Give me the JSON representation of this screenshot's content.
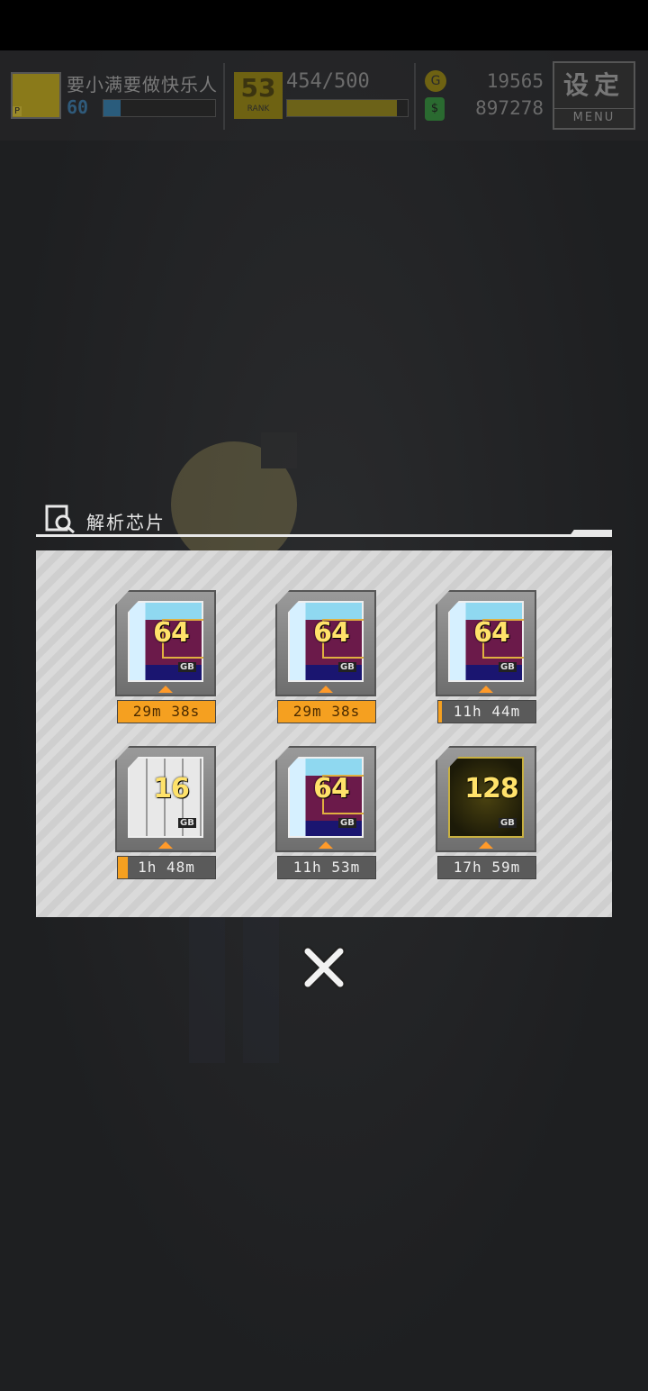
{
  "hud": {
    "player_name": "要小满要做快乐人",
    "avatar_tag": "P",
    "level": "60",
    "level_progress": 0.15,
    "rank": "53",
    "rank_label": "RANK",
    "stamina_text": "454/500",
    "stamina_progress": 0.908,
    "coin_value": "19565",
    "gem_value": "897278",
    "menu_cn": "设定",
    "menu_en": "MENU"
  },
  "dialog": {
    "title": "解析芯片",
    "chips": [
      {
        "capacity": "64",
        "unit": "GB",
        "type": "rainbow",
        "timer": "29m 38s",
        "progress": 1.0
      },
      {
        "capacity": "64",
        "unit": "GB",
        "type": "rainbow",
        "timer": "29m 38s",
        "progress": 1.0
      },
      {
        "capacity": "64",
        "unit": "GB",
        "type": "rainbow",
        "timer": "11h 44m",
        "progress": 0.02
      },
      {
        "capacity": "16",
        "unit": "GB",
        "type": "silver",
        "timer": "1h 48m",
        "progress": 0.1
      },
      {
        "capacity": "64",
        "unit": "GB",
        "type": "rainbow",
        "timer": "11h 53m",
        "progress": 0.0
      },
      {
        "capacity": "128",
        "unit": "GB",
        "type": "gold",
        "timer": "17h 59m",
        "progress": 0.0
      }
    ]
  },
  "colors": {
    "timer_fill": "#f5a020",
    "panel_bg": "#d4d4d4"
  }
}
